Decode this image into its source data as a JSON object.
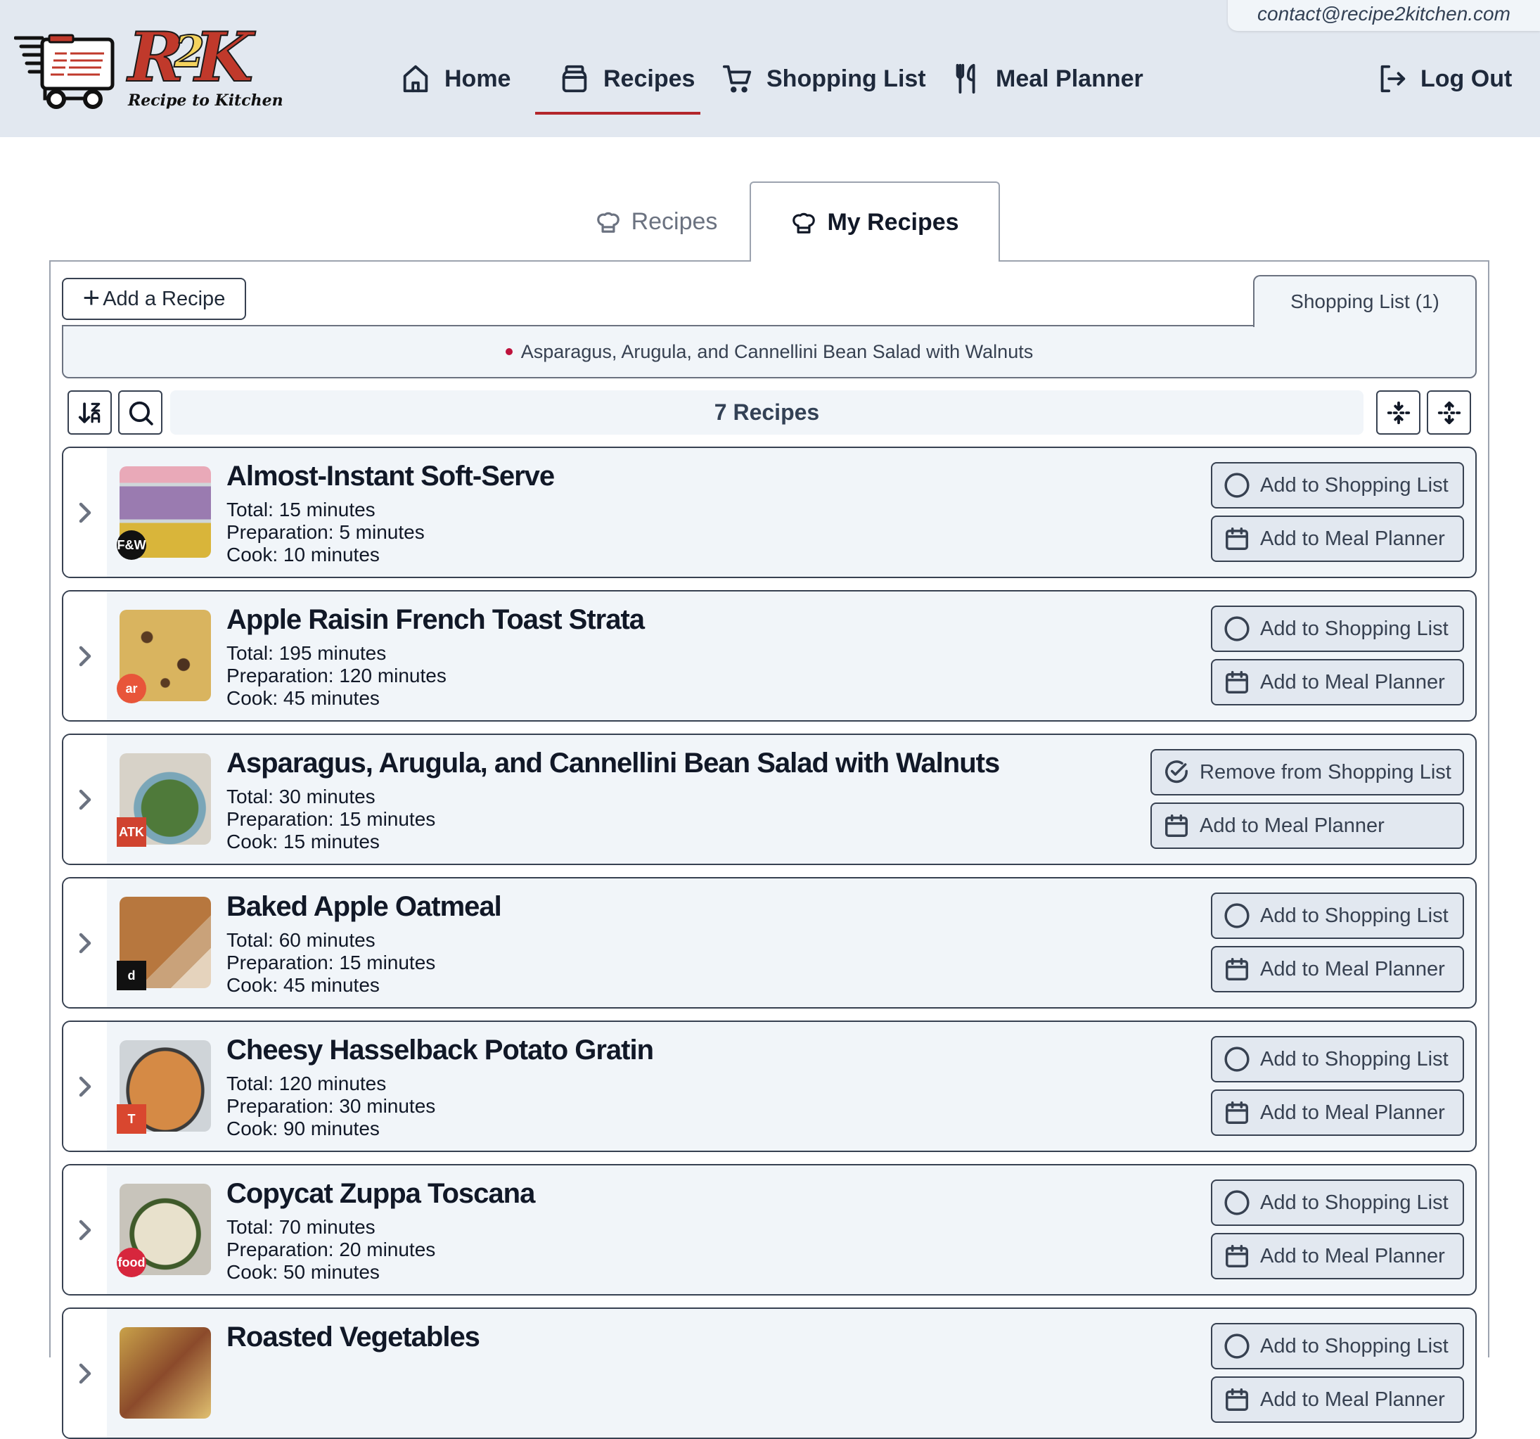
{
  "header": {
    "logo_text": "R2K",
    "logo_tagline": "Recipe to Kitchen",
    "contact_email": "contact@recipe2kitchen.com",
    "nav": [
      {
        "label": "Home",
        "icon": "home-icon",
        "active": false
      },
      {
        "label": "Recipes",
        "icon": "jar-icon",
        "active": true
      },
      {
        "label": "Shopping List",
        "icon": "cart-icon",
        "active": false
      },
      {
        "label": "Meal Planner",
        "icon": "utensils-icon",
        "active": false
      }
    ],
    "logout_label": "Log Out",
    "accent_color": "#b3262b"
  },
  "tabs": [
    {
      "label": "Recipes",
      "icon": "chef-hat-icon",
      "active": false
    },
    {
      "label": "My Recipes",
      "icon": "chef-hat-icon",
      "active": true
    }
  ],
  "toolbar": {
    "add_recipe_label": "Add a Recipe",
    "shopping_list_tab_label": "Shopping List (1)",
    "shopping_list_items": [
      "Asparagus, Arugula, and Cannellini Bean Salad with Walnuts"
    ],
    "recipe_count_label": "7 Recipes",
    "sort_icon": "sort-z-a-icon",
    "search_icon": "search-icon",
    "collapse_icon": "collapse-all-icon",
    "expand_icon": "expand-all-icon"
  },
  "recipes": [
    {
      "title": "Almost-Instant Soft-Serve",
      "total": "Total: 15 minutes",
      "prep": "Preparation: 5 minutes",
      "cook": "Cook: 10 minutes",
      "source": "F&W",
      "source_color": "#111111",
      "in_shopping_list": false,
      "shop_label": "Add to Shopping List",
      "meal_label": "Add to Meal Planner"
    },
    {
      "title": "Apple Raisin French Toast Strata",
      "total": "Total: 195 minutes",
      "prep": "Preparation: 120 minutes",
      "cook": "Cook: 45 minutes",
      "source": "ar",
      "source_color": "#e8553a",
      "in_shopping_list": false,
      "shop_label": "Add to Shopping List",
      "meal_label": "Add to Meal Planner"
    },
    {
      "title": "Asparagus, Arugula, and Cannellini Bean Salad with Walnuts",
      "total": "Total: 30 minutes",
      "prep": "Preparation: 15 minutes",
      "cook": "Cook: 15 minutes",
      "source": "ATK",
      "source_color": "#d0432f",
      "in_shopping_list": true,
      "shop_label": "Remove from Shopping List",
      "meal_label": "Add to Meal Planner"
    },
    {
      "title": "Baked Apple Oatmeal",
      "total": "Total: 60 minutes",
      "prep": "Preparation: 15 minutes",
      "cook": "Cook: 45 minutes",
      "source": "d",
      "source_color": "#111111",
      "in_shopping_list": false,
      "shop_label": "Add to Shopping List",
      "meal_label": "Add to Meal Planner"
    },
    {
      "title": "Cheesy Hasselback Potato Gratin",
      "total": "Total: 120 minutes",
      "prep": "Preparation: 30 minutes",
      "cook": "Cook: 90 minutes",
      "source": "T",
      "source_color": "#d9472f",
      "in_shopping_list": false,
      "shop_label": "Add to Shopping List",
      "meal_label": "Add to Meal Planner"
    },
    {
      "title": "Copycat Zuppa Toscana",
      "total": "Total: 70 minutes",
      "prep": "Preparation: 20 minutes",
      "cook": "Cook: 50 minutes",
      "source": "food",
      "source_color": "#d7263d",
      "in_shopping_list": false,
      "shop_label": "Add to Shopping List",
      "meal_label": "Add to Meal Planner"
    },
    {
      "title": "Roasted Vegetables",
      "total": "",
      "prep": "",
      "cook": "",
      "source": "",
      "source_color": "#888888",
      "in_shopping_list": false,
      "shop_label": "Add to Shopping List",
      "meal_label": "Add to Meal Planner"
    }
  ]
}
